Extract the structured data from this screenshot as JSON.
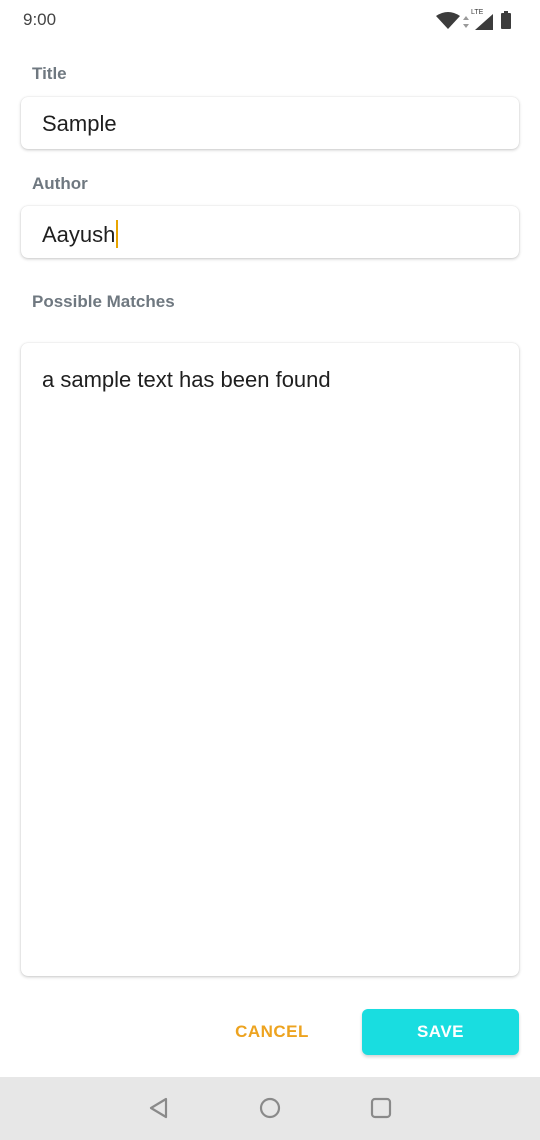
{
  "status_bar": {
    "time": "9:00",
    "network_label": "LTE",
    "icons": [
      "wifi-icon",
      "cellular-signal-icon",
      "battery-icon"
    ]
  },
  "form": {
    "title_label": "Title",
    "title_value": "Sample",
    "author_label": "Author",
    "author_value": "Aayush",
    "matches_label": "Possible Matches",
    "matches_text": "a sample text has been found"
  },
  "actions": {
    "cancel_label": "CANCEL",
    "save_label": "SAVE"
  },
  "nav_bar": {
    "buttons": [
      "back-icon",
      "home-icon",
      "recents-icon"
    ]
  },
  "colors": {
    "accent": "#19dde0",
    "cancel_text": "#eda31f",
    "caret": "#e8a400",
    "label_text": "#6f7880",
    "nav_background": "#e7e7e7"
  }
}
